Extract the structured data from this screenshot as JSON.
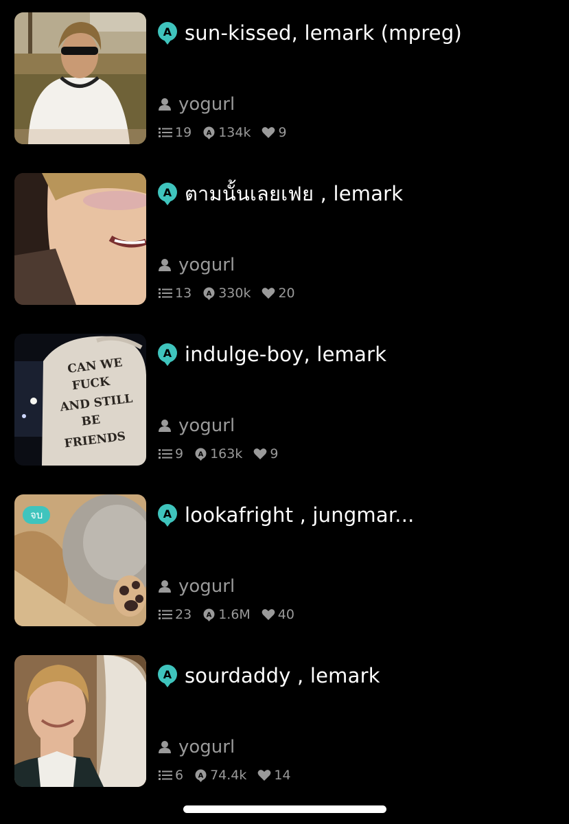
{
  "stories": [
    {
      "title": "sun-kissed, lemark (mpreg)",
      "author": "yogurl",
      "chapters": "19",
      "views": "134k",
      "likes": "9",
      "status_badge": ""
    },
    {
      "title": "ตามนั้นเลยเฟย , lemark",
      "author": "yogurl",
      "chapters": "13",
      "views": "330k",
      "likes": "20",
      "status_badge": ""
    },
    {
      "title": "indulge-boy, lemark",
      "author": "yogurl",
      "chapters": "9",
      "views": "163k",
      "likes": "9",
      "status_badge": ""
    },
    {
      "title": "lookafright , jungmar...",
      "author": "yogurl",
      "chapters": "23",
      "views": "1.6M",
      "likes": "40",
      "status_badge": "จบ"
    },
    {
      "title": "sourdaddy , lemark",
      "author": "yogurl",
      "chapters": "6",
      "views": "74.4k",
      "likes": "14",
      "status_badge": ""
    }
  ],
  "cover3_text": [
    "CAN WE",
    "FUCK",
    "AND STILL",
    "BE",
    "FRIENDS"
  ],
  "icons": {
    "type": "story-type-icon",
    "author": "user-icon",
    "chapters": "list-icon",
    "views": "views-bubble-icon",
    "likes": "heart-icon"
  },
  "colors": {
    "background": "#000000",
    "accent": "#3fc4bd",
    "muted": "#9a9a9a",
    "text": "#ffffff"
  }
}
